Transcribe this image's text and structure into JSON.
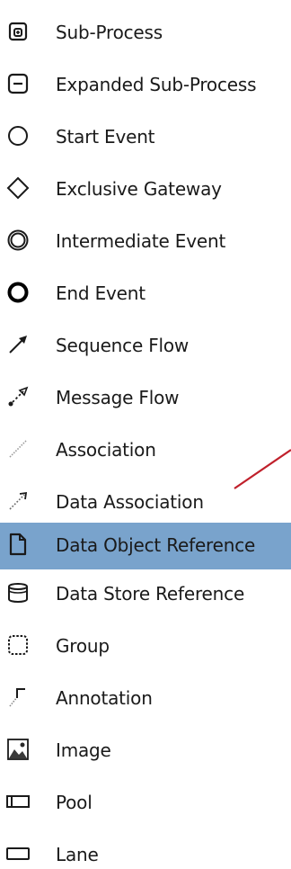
{
  "palette": {
    "items": [
      {
        "label": "Sub-Process",
        "icon": "sub-process-icon"
      },
      {
        "label": "Expanded Sub-Process",
        "icon": "expanded-sub-process-icon"
      },
      {
        "label": "Start Event",
        "icon": "start-event-icon"
      },
      {
        "label": "Exclusive Gateway",
        "icon": "exclusive-gateway-icon"
      },
      {
        "label": "Intermediate Event",
        "icon": "intermediate-event-icon"
      },
      {
        "label": "End Event",
        "icon": "end-event-icon"
      },
      {
        "label": "Sequence Flow",
        "icon": "sequence-flow-icon"
      },
      {
        "label": "Message Flow",
        "icon": "message-flow-icon"
      },
      {
        "label": "Association",
        "icon": "association-icon"
      },
      {
        "label": "Data Association",
        "icon": "data-association-icon"
      },
      {
        "label": "Data Object Reference",
        "icon": "data-object-reference-icon",
        "selected": true
      },
      {
        "label": "Data Store Reference",
        "icon": "data-store-reference-icon"
      },
      {
        "label": "Group",
        "icon": "group-icon"
      },
      {
        "label": "Annotation",
        "icon": "annotation-icon"
      },
      {
        "label": "Image",
        "icon": "image-icon"
      },
      {
        "label": "Pool",
        "icon": "pool-icon"
      },
      {
        "label": "Lane",
        "icon": "lane-icon"
      }
    ],
    "colors": {
      "selected_background": "#79a3cc",
      "pointer_line": "#c0202b"
    }
  }
}
